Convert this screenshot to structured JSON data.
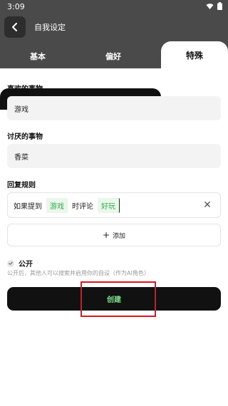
{
  "status": {
    "time": "3:09"
  },
  "header": {
    "title": "自我设定"
  },
  "tabs": [
    {
      "label": "基本"
    },
    {
      "label": "偏好"
    },
    {
      "label": "特殊"
    }
  ],
  "likes": {
    "label": "喜欢的事物",
    "value": "游戏"
  },
  "dislikes": {
    "label": "讨厌的事物",
    "value": "香菜"
  },
  "reply_rules": {
    "label": "回复规则",
    "rule": {
      "prefix": "如果提到",
      "keyword": "游戏",
      "middle": "时评论",
      "response": "好玩"
    },
    "add_label": "添加"
  },
  "public": {
    "label": "公开",
    "note": "公开后，其他人可以搜索并启用你的自设（作为AI角色）"
  },
  "create_button": {
    "label": "创建"
  },
  "colors": {
    "accent_green": "#2fa84f",
    "highlight_red": "#e0141a",
    "dark": "#111111"
  }
}
